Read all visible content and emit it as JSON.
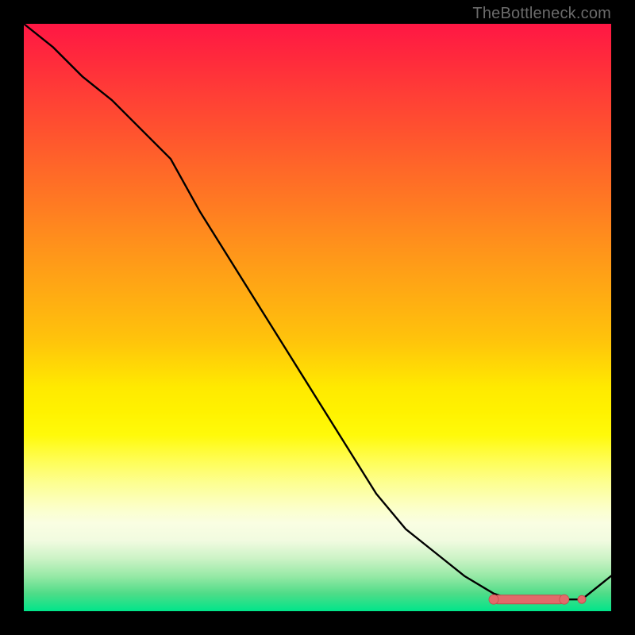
{
  "attribution": "TheBottleneck.com",
  "colors": {
    "page_bg": "#000000",
    "gradient_top": "#ff1744",
    "gradient_mid": "#ffea00",
    "gradient_bottom": "#00e58a",
    "line": "#000000",
    "marker_fill": "#e26a6a",
    "marker_stroke": "#c24d4d"
  },
  "chart_data": {
    "type": "line",
    "title": "",
    "xlabel": "",
    "ylabel": "",
    "xlim": [
      0,
      100
    ],
    "ylim": [
      0,
      100
    ],
    "grid": false,
    "series": [
      {
        "name": "curve",
        "x": [
          0,
          5,
          10,
          15,
          20,
          25,
          30,
          35,
          40,
          45,
          50,
          55,
          60,
          65,
          70,
          75,
          80,
          83,
          86,
          89,
          92,
          95,
          100
        ],
        "y": [
          100,
          96,
          91,
          87,
          82,
          77,
          68,
          60,
          52,
          44,
          36,
          28,
          20,
          14,
          10,
          6,
          3,
          2,
          2,
          2,
          2,
          2,
          6
        ]
      }
    ],
    "annotations": [
      {
        "name": "highlight-segment",
        "shape": "rounded-bar",
        "x_start": 80,
        "x_end": 92,
        "y": 2
      },
      {
        "name": "highlight-dot",
        "shape": "dot",
        "x": 95,
        "y": 2
      }
    ]
  }
}
